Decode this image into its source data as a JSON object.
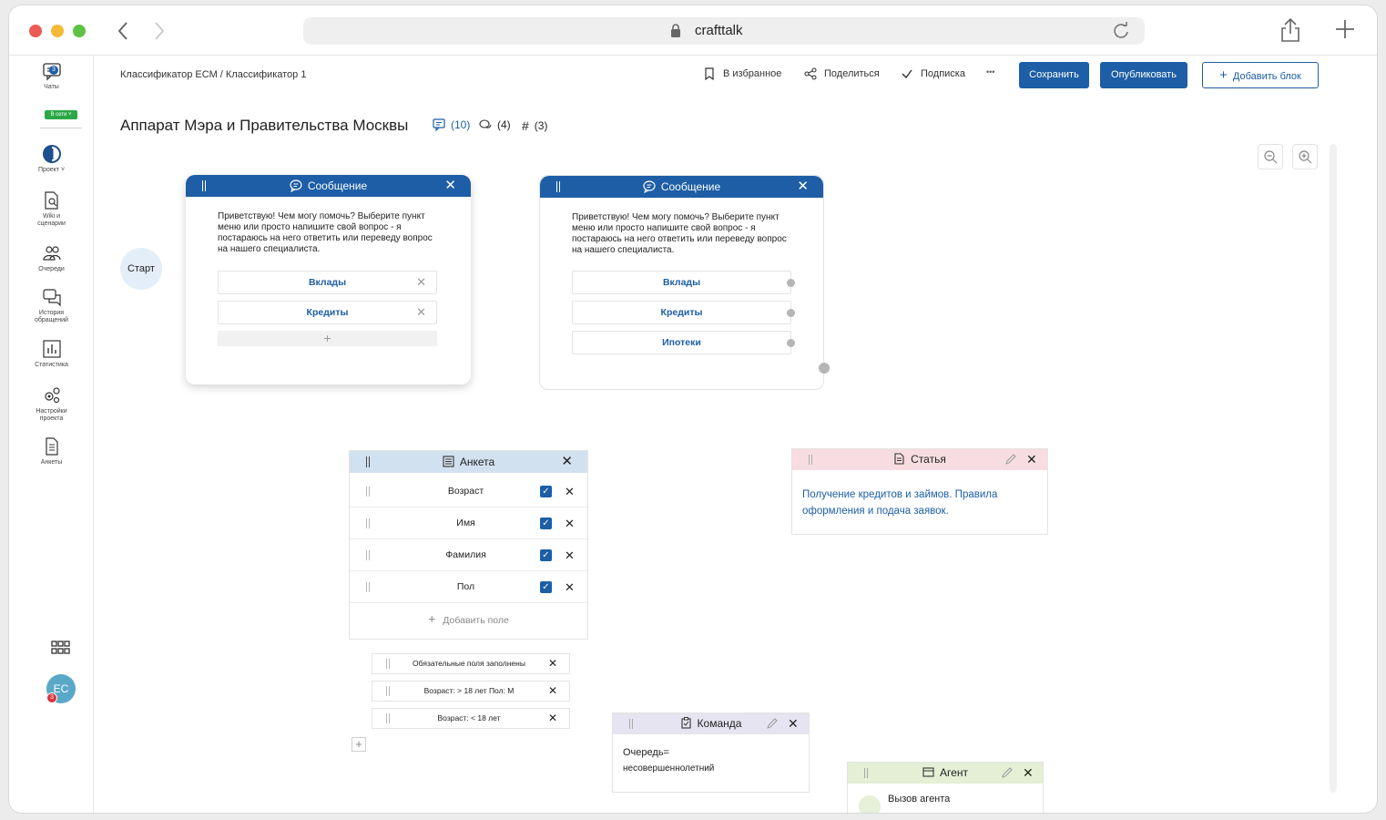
{
  "browser": {
    "url": "crafttalk"
  },
  "sidebar": {
    "chats_label": "Чаты",
    "chats_count": "3",
    "status_label": "В сети",
    "project_label": "Проект",
    "items": [
      {
        "label": "Wiki и\nсценарии",
        "icon": "wiki-icon"
      },
      {
        "label": "Очереди",
        "icon": "queues-icon"
      },
      {
        "label": "История\nобращений",
        "icon": "history-icon"
      },
      {
        "label": "Статистика",
        "icon": "statistics-icon"
      },
      {
        "label": "Настройки\nпроекта",
        "icon": "settings-icon"
      },
      {
        "label": "Анкеты",
        "icon": "forms-icon"
      }
    ],
    "avatar_initials": "ЕС",
    "avatar_badge": "3"
  },
  "toolbar": {
    "breadcrumb": "Классификатор ЕСМ / Классификатор 1",
    "favorite_label": "В избранное",
    "share_label": "Поделиться",
    "subscribe_label": "Подписка",
    "more_label": "•••",
    "save_label": "Сохранить",
    "publish_label": "Опубликовать",
    "add_block_label": "Добавить блок"
  },
  "header": {
    "title": "Аппарат Мэра и Правительства Москвы",
    "stats": {
      "messages": "(10)",
      "comments": "(4)",
      "tags": "(3)"
    }
  },
  "canvas": {
    "start_label": "Старт",
    "message_left": {
      "title": "Сообщение",
      "text": "Приветствую! Чем могу помочь? Выберите пункт меню или просто напишите свой вопрос - я постараюсь на него ответить или переведу вопрос на нашего специалиста.",
      "options": [
        "Вклады",
        "Кредиты"
      ],
      "add_label": "+"
    },
    "message_right": {
      "title": "Сообщение",
      "text": "Приветствую! Чем могу помочь? Выберите пункт меню или просто напишите свой вопрос - я постараюсь на него ответить или переведу вопрос на нашего специалиста.",
      "options": [
        "Вклады",
        "Кредиты",
        "Ипотеки"
      ]
    },
    "form": {
      "title": "Анкета",
      "fields": [
        "Возраст",
        "Имя",
        "Фамилия",
        "Пол"
      ],
      "add_field_label": "Добавить поле"
    },
    "conditions": [
      "Обязательные поля заполнены",
      "Возраст: > 18 лет  Пол: М",
      "Возраст: < 18 лет"
    ],
    "article": {
      "title": "Статья",
      "text": "Получение кредитов и займов. Правила оформления и подача заявок."
    },
    "command": {
      "title": "Команда",
      "line1": "Очередь=",
      "line2": "несовершеннолетний"
    },
    "agent": {
      "title": "Агент",
      "text": "Вызов агента"
    }
  },
  "colors": {
    "primary": "#1d5ea6",
    "form_header": "#d2e1ef",
    "article_header": "#f7dde1",
    "command_header": "#e6e4f0",
    "agent_header": "#e4efd5",
    "online": "#2aa845"
  }
}
